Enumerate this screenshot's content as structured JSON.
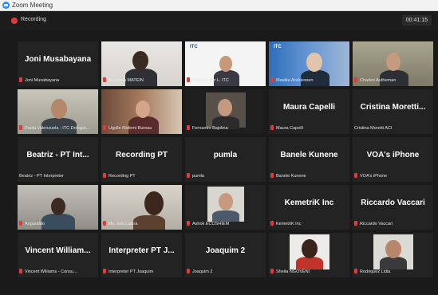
{
  "window": {
    "title": "Zoom Meeting"
  },
  "topbar": {
    "recording_label": "Recording",
    "timer": "00:41:15"
  },
  "accent": {
    "active_speaker": "#c9e04a",
    "recording_red": "#e03a3a",
    "zoom_blue": "#2d8cff"
  },
  "participants": [
    {
      "big": "Joni Musabayana",
      "name": "Joni Musabayana"
    },
    {
      "big": "",
      "name": "Mosibela MATEIN"
    },
    {
      "big": "",
      "name": "Miguel Cruz L. ITC",
      "logo": "ITC"
    },
    {
      "big": "",
      "name": "Maaike Andriessen",
      "logo": "ITC"
    },
    {
      "big": "",
      "name": "Charles Autheman"
    },
    {
      "big": "",
      "name": "Paola Valenzuela - ITC Delegat..."
    },
    {
      "big": "",
      "name": "Ugolle Mafemi Bureau"
    },
    {
      "big": "",
      "name": "Fernando Bajolina"
    },
    {
      "big": "Maura Capelli",
      "name": "Maura Capelli"
    },
    {
      "big": "Cristina Moretti...",
      "name": "Cristina Moretti ACI"
    },
    {
      "big": "Beatriz - PT Int...",
      "name": "Beatriz - PT Interpreter"
    },
    {
      "big": "Recording PT",
      "name": "Recording PT"
    },
    {
      "big": "pumla",
      "name": "pumla"
    },
    {
      "big": "Banele Kunene",
      "name": "Banele Kunene"
    },
    {
      "big": "VOA's iPhone",
      "name": "VOA's iPhone"
    },
    {
      "big": "",
      "name": "Anguraldo"
    },
    {
      "big": "",
      "name": "Ms. Iata Lalura"
    },
    {
      "big": "",
      "name": "Ashok ECOSHIEM"
    },
    {
      "big": "KemetriK Inc",
      "name": "KemetriK Inc"
    },
    {
      "big": "Riccardo Vaccari",
      "name": "Riccardo Vaccari"
    },
    {
      "big": "Vincent William...",
      "name": "Vincent Williams - Consu..."
    },
    {
      "big": "Interpreter PT J...",
      "name": "Interpreter PT Joaquim"
    },
    {
      "big": "Joaquim 2",
      "name": "Joaquim 2"
    },
    {
      "big": "",
      "name": "Sheila NGOVENI"
    },
    {
      "big": "",
      "name": "Rodriquez Lidia"
    }
  ]
}
